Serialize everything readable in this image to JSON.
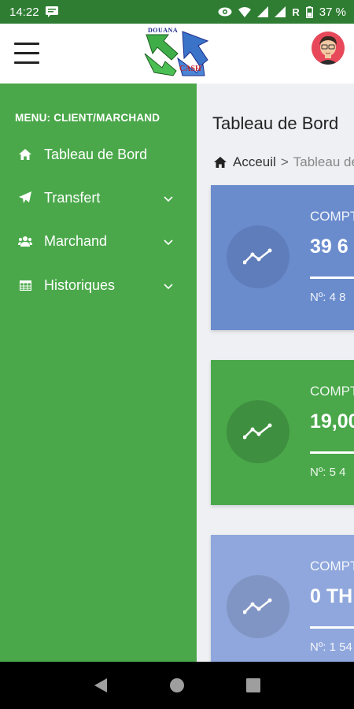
{
  "status_bar": {
    "time": "14:22",
    "battery": "37 %",
    "network_label": "R"
  },
  "header": {
    "logo_text_top": "DOUANA",
    "logo_text_bottom": "CASH"
  },
  "sidebar": {
    "menu_title": "MENU: CLIENT/MARCHAND",
    "items": [
      {
        "label": "Tableau de Bord",
        "icon": "home-icon"
      },
      {
        "label": "Transfert",
        "icon": "paper-plane-icon"
      },
      {
        "label": "Marchand",
        "icon": "users-icon"
      },
      {
        "label": "Historiques",
        "icon": "table-icon"
      }
    ]
  },
  "main": {
    "page_title": "Tableau de Bord",
    "breadcrumb": {
      "home": "Acceuil",
      "separator": ">",
      "current": "Tableau de Bord"
    },
    "cards": [
      {
        "label": "COMPTE",
        "value": "39 6",
        "number": "Nº: 4 8",
        "color": "#6a8ccd",
        "circle_color": "#5f7dbb"
      },
      {
        "label": "COMPTE",
        "value": "19,00",
        "number": "Nº: 5 4",
        "color": "#4aa84a",
        "circle_color": "#3f8f40"
      },
      {
        "label": "COMPTE",
        "value": "0 TH",
        "number": "Nº: 1 54",
        "color": "#8fa7dc",
        "circle_color": "#8095c4"
      }
    ]
  },
  "colors": {
    "status_bar": "#2e7d32",
    "sidebar": "#4aa84a",
    "background": "#eef0f4"
  }
}
